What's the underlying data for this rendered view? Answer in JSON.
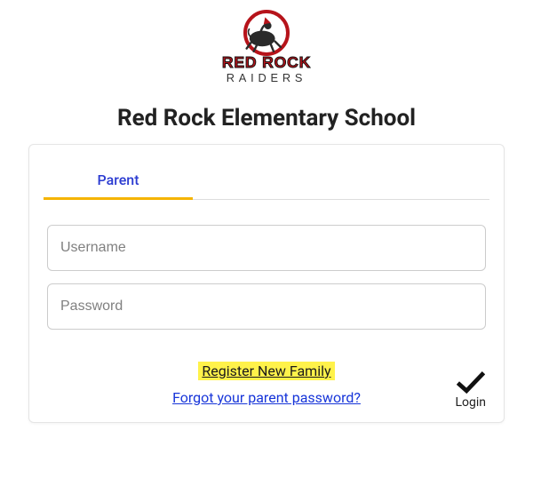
{
  "logo": {
    "top_text": "RED ROCK",
    "bottom_text": "RAIDERS",
    "primary_color": "#b6131a",
    "accent_color": "#111"
  },
  "header": {
    "title": "Red Rock Elementary School"
  },
  "tabs": {
    "parent": "Parent"
  },
  "form": {
    "username_placeholder": "Username",
    "password_placeholder": "Password"
  },
  "links": {
    "register": "Register New Family",
    "forgot": "Forgot your parent password?"
  },
  "login": {
    "label": "Login"
  }
}
